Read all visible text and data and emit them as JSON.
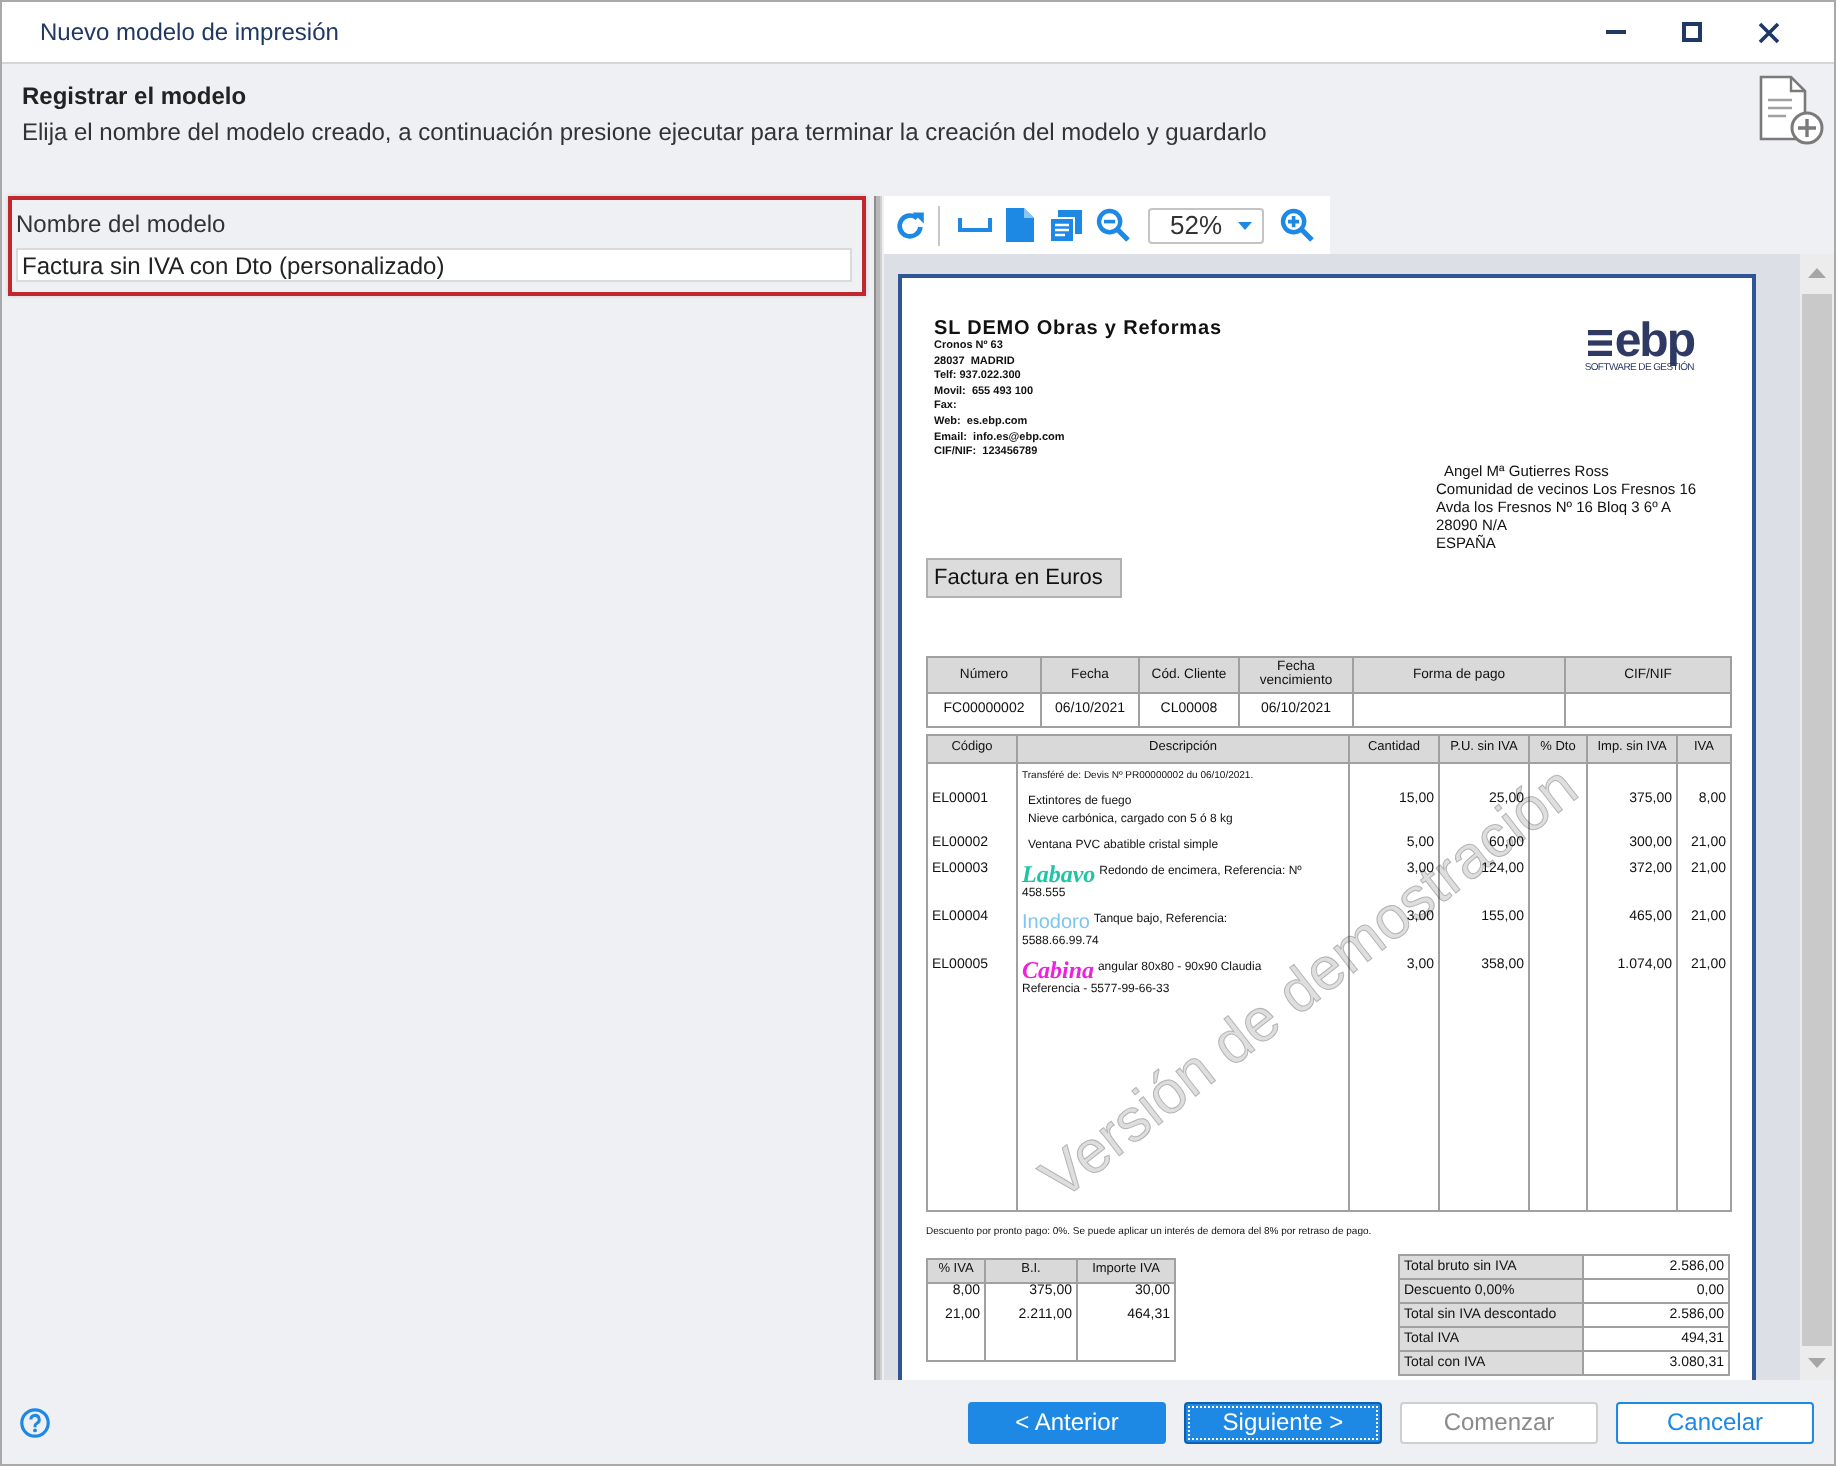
{
  "window": {
    "title": "Nuevo modelo de impresión"
  },
  "header": {
    "title": "Registrar el modelo",
    "description": "Elija el nombre del modelo creado, a continuación presione ejecutar para terminar la creación del modelo y guardarlo"
  },
  "model_name": {
    "label": "Nombre del modelo",
    "value": "Factura sin IVA con Dto (personalizado)"
  },
  "preview_toolbar": {
    "zoom": "52%"
  },
  "document": {
    "company": {
      "name": "SL DEMO Obras y Reformas",
      "lines": [
        "Cronos Nº 63",
        "28037  MADRID",
        "Telf: 937.022.300",
        "Movil:  655 493 100",
        "Fax:",
        "Web:  es.ebp.com",
        "Email:  info.es@ebp.com",
        "CIF/NIF:  123456789"
      ]
    },
    "logo": {
      "text": "ebp",
      "tagline": "SOFTWARE DE GESTIÓN"
    },
    "customer": [
      "Angel Mª Gutierres Ross",
      "Comunidad de vecinos Los Fresnos 16",
      "Avda los Fresnos Nº 16 Bloq 3 6º A",
      "28090 N/A",
      "ESPAÑA"
    ],
    "title": "Factura en Euros",
    "summary": {
      "columns": [
        "Número",
        "Fecha",
        "Cód. Cliente",
        "Fecha vencimiento",
        "Forma de pago",
        "CIF/NIF"
      ],
      "values": [
        "FC00000002",
        "06/10/2021",
        "CL00008",
        "06/10/2021"
      ]
    },
    "lines": {
      "columns": [
        "Código",
        "Descripción",
        "Cantidad",
        "P.U. sin IVA",
        "% Dto",
        "Imp. sin IVA",
        "IVA"
      ],
      "note": "Transféré de: Devis Nº PR00000002 du 06/10/2021.",
      "rows": [
        {
          "code": "EL00001",
          "description": [
            "Extintores de fuego",
            "Nieve carbónica, cargado con 5 ó 8 kg"
          ],
          "quantity": "15,00",
          "unit_price": "25,00",
          "amount": "375,00",
          "vat": "8,00"
        },
        {
          "code": "EL00002",
          "description": [
            "Ventana PVC abatible cristal simple"
          ],
          "quantity": "5,00",
          "unit_price": "60,00",
          "amount": "300,00",
          "vat": "21,00"
        },
        {
          "code": "EL00003",
          "brand": {
            "text": "Labavo",
            "kind": "script",
            "color": "#1fc4a4"
          },
          "description": [
            "Redondo de encimera, Referencia: Nº",
            "458.555"
          ],
          "quantity": "3,00",
          "unit_price": "124,00",
          "amount": "372,00",
          "vat": "21,00"
        },
        {
          "code": "EL00004",
          "brand": {
            "text": "Inodoro",
            "kind": "plain",
            "color": "#7cc6ef"
          },
          "description": [
            "Tanque bajo, Referencia:",
            "5588.66.99.74"
          ],
          "quantity": "3,00",
          "unit_price": "155,00",
          "amount": "465,00",
          "vat": "21,00"
        },
        {
          "code": "EL00005",
          "brand": {
            "text": "Cabina",
            "kind": "script",
            "color": "#ee22dd"
          },
          "description": [
            "angular 80x80 - 90x90 Claudia",
            "Referencia - 5577-99-66-33"
          ],
          "quantity": "3,00",
          "unit_price": "358,00",
          "amount": "1.074,00",
          "vat": "21,00"
        }
      ]
    },
    "footer_note": "Descuento por pronto pago: 0%. Se puede aplicar un interés de demora del 8% por retraso de pago.",
    "vat_table": {
      "columns": [
        "% IVA",
        "B.I.",
        "Importe IVA"
      ],
      "rows": [
        [
          "8,00",
          "375,00",
          "30,00"
        ],
        [
          "21,00",
          "2.211,00",
          "464,31"
        ]
      ]
    },
    "totals": [
      {
        "label": "Total bruto sin IVA",
        "value": "2.586,00"
      },
      {
        "label": "Descuento 0,00%",
        "value": "0,00"
      },
      {
        "label": "Total sin IVA descontado",
        "value": "2.586,00"
      },
      {
        "label": "Total IVA",
        "value": "494,31"
      },
      {
        "label": "Total con IVA",
        "value": "3.080,31"
      }
    ],
    "watermark": "Versión de demostración"
  },
  "buttons": [
    {
      "label": "< Anterior",
      "kind": "primary",
      "disabled": false,
      "focused": false
    },
    {
      "label": "Siguiente >",
      "kind": "primary",
      "disabled": false,
      "focused": true
    },
    {
      "label": "Comenzar",
      "kind": "secondary",
      "disabled": true,
      "focused": false
    },
    {
      "label": "Cancelar",
      "kind": "secondary",
      "disabled": false,
      "focused": false
    }
  ]
}
